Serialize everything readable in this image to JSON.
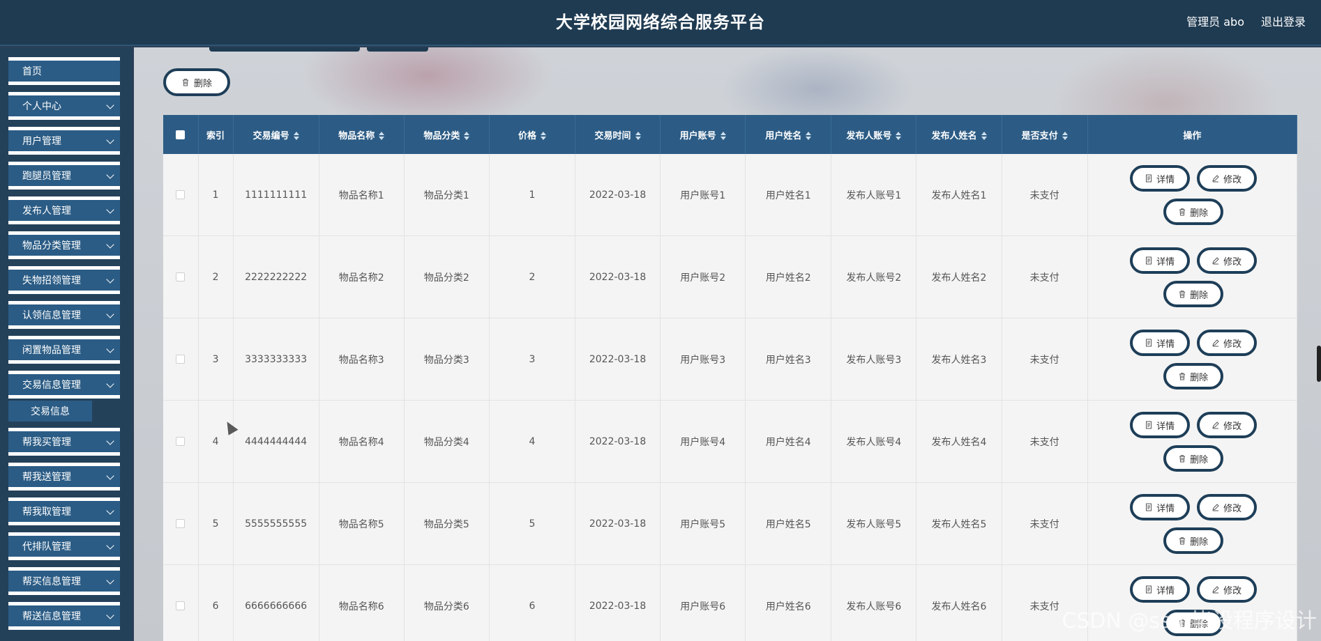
{
  "header": {
    "title": "大学校园网络综合服务平台",
    "user": "管理员 abo",
    "logout": "退出登录"
  },
  "sidebar": {
    "items": [
      {
        "label": "首页",
        "expandable": false
      },
      {
        "label": "个人中心",
        "expandable": true
      },
      {
        "label": "用户管理",
        "expandable": true
      },
      {
        "label": "跑腿员管理",
        "expandable": true
      },
      {
        "label": "发布人管理",
        "expandable": true
      },
      {
        "label": "物品分类管理",
        "expandable": true
      },
      {
        "label": "失物招领管理",
        "expandable": true
      },
      {
        "label": "认领信息管理",
        "expandable": true
      },
      {
        "label": "闲置物品管理",
        "expandable": true
      },
      {
        "label": "交易信息管理",
        "expandable": true
      },
      {
        "label": "帮我买管理",
        "expandable": true
      },
      {
        "label": "帮我送管理",
        "expandable": true
      },
      {
        "label": "帮我取管理",
        "expandable": true
      },
      {
        "label": "代排队管理",
        "expandable": true
      },
      {
        "label": "帮买信息管理",
        "expandable": true
      },
      {
        "label": "帮送信息管理",
        "expandable": true
      }
    ],
    "submenu": {
      "label": "交易信息"
    }
  },
  "toolbar": {
    "delete_label": "删除"
  },
  "table": {
    "columns": [
      "索引",
      "交易编号",
      "物品名称",
      "物品分类",
      "价格",
      "交易时间",
      "用户账号",
      "用户姓名",
      "发布人账号",
      "发布人姓名",
      "是否支付",
      "操作"
    ],
    "rows": [
      [
        "1",
        "1111111111",
        "物品名称1",
        "物品分类1",
        "1",
        "2022-03-18",
        "用户账号1",
        "用户姓名1",
        "发布人账号1",
        "发布人姓名1",
        "未支付"
      ],
      [
        "2",
        "2222222222",
        "物品名称2",
        "物品分类2",
        "2",
        "2022-03-18",
        "用户账号2",
        "用户姓名2",
        "发布人账号2",
        "发布人姓名2",
        "未支付"
      ],
      [
        "3",
        "3333333333",
        "物品名称3",
        "物品分类3",
        "3",
        "2022-03-18",
        "用户账号3",
        "用户姓名3",
        "发布人账号3",
        "发布人姓名3",
        "未支付"
      ],
      [
        "4",
        "4444444444",
        "物品名称4",
        "物品分类4",
        "4",
        "2022-03-18",
        "用户账号4",
        "用户姓名4",
        "发布人账号4",
        "发布人姓名4",
        "未支付"
      ],
      [
        "5",
        "5555555555",
        "物品名称5",
        "物品分类5",
        "5",
        "2022-03-18",
        "用户账号5",
        "用户姓名5",
        "发布人账号5",
        "发布人姓名5",
        "未支付"
      ],
      [
        "6",
        "6666666666",
        "物品名称6",
        "物品分类6",
        "6",
        "2022-03-18",
        "用户账号6",
        "用户姓名6",
        "发布人账号6",
        "发布人姓名6",
        "未支付"
      ]
    ],
    "actions": {
      "detail": "详情",
      "edit": "修改",
      "delete": "删除"
    }
  },
  "watermark": "CSDN @ssm毕设程序设计",
  "colors": {
    "header_bg": "#1f3b52",
    "accent": "#2c5c85",
    "button_border": "#1e3e58"
  }
}
